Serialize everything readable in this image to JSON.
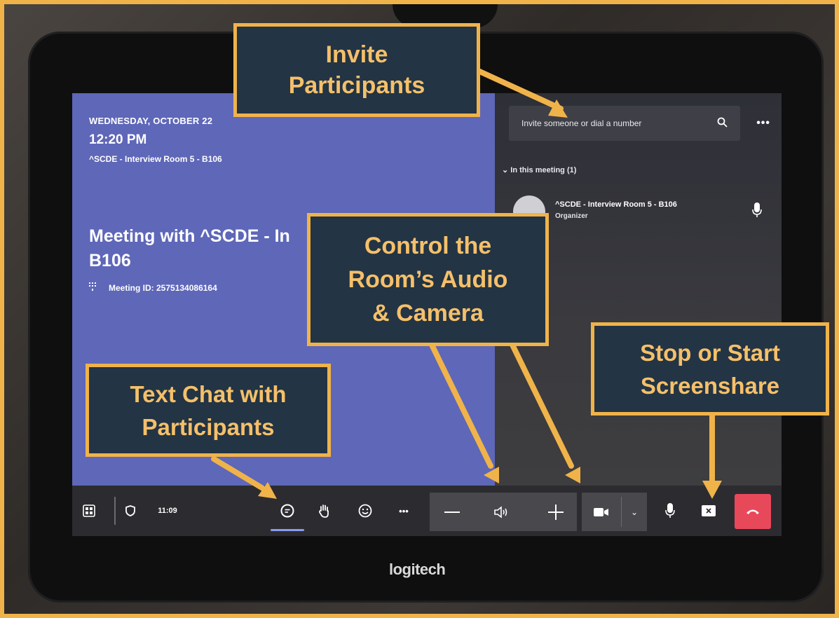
{
  "screen": {
    "date": "WEDNESDAY, OCTOBER 22",
    "time": "12:20 PM",
    "room": "^SCDE - Interview Room 5 - B106",
    "meeting_title_line1": "Meeting with ^SCDE - In",
    "meeting_title_line2": "B106",
    "meeting_id": "Meeting ID: 2575134086164"
  },
  "participants_panel": {
    "search_placeholder": "Invite someone or dial a number",
    "section_label": "In this meeting (1)",
    "participant_name": "^SCDE - Interview Room 5 - B106",
    "participant_role": "Organizer"
  },
  "toolbar": {
    "clock": "11:09"
  },
  "device": {
    "brand": "logitech"
  },
  "callouts": {
    "invite_line1": "Invite",
    "invite_line2": "Participants",
    "control_line1": "Control the",
    "control_line2": "Room’s Audio",
    "control_line3": "& Camera",
    "chat_line1": "Text Chat with",
    "chat_line2": "Participants",
    "share_line1": "Stop or Start",
    "share_line2": "Screenshare"
  },
  "colors": {
    "accent_border": "#f0b34a",
    "callout_bg": "#233444",
    "callout_text": "#f5c06a",
    "end_call": "#e8495a",
    "meeting_pane": "#5e67b8"
  }
}
